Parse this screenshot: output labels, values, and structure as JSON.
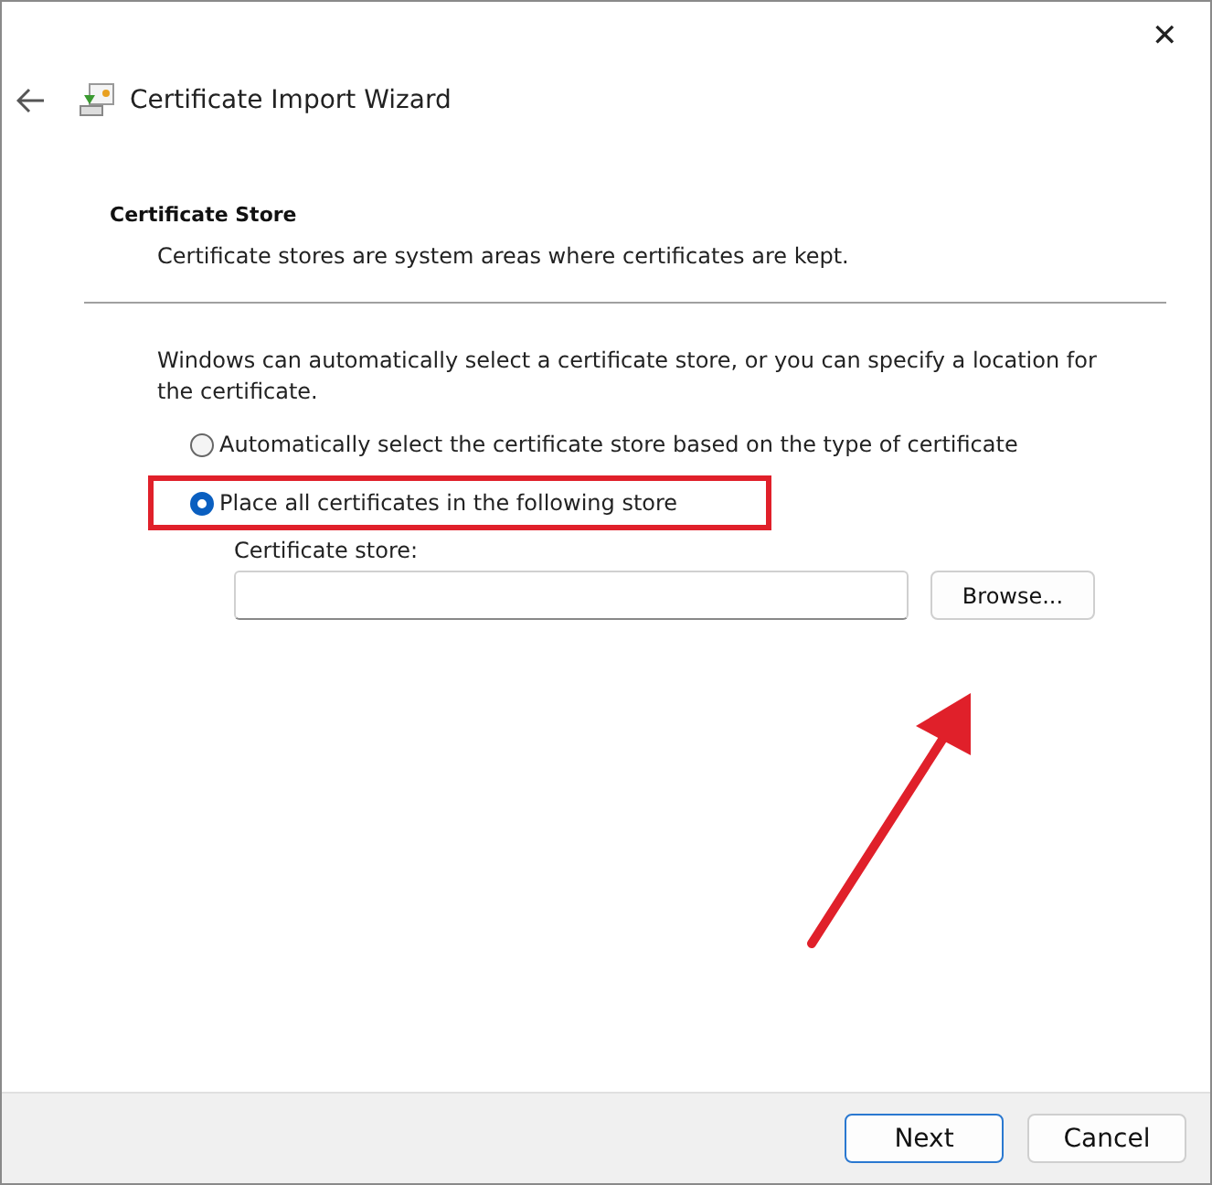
{
  "window": {
    "title": "Certificate Import Wizard",
    "close": "✕"
  },
  "section": {
    "title": "Certificate Store",
    "subtitle": "Certificate stores are system areas where certificates are kept."
  },
  "intro": "Windows can automatically select a certificate store, or you can specify a location for the certificate.",
  "options": [
    {
      "label": "Automatically select the certificate store based on the type of certificate",
      "selected": false,
      "highlighted": false
    },
    {
      "label": "Place all certificates in the following store",
      "selected": true,
      "highlighted": true
    }
  ],
  "store": {
    "label": "Certificate store:",
    "browse": "Browse..."
  },
  "annotation": {
    "arrow": true
  },
  "buttons": [
    {
      "label": "Next",
      "default": true
    },
    {
      "label": "Cancel",
      "default": false
    }
  ]
}
